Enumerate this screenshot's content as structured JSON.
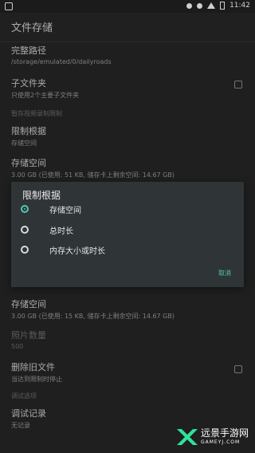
{
  "status_bar": {
    "time": "11:42"
  },
  "app_bar": {
    "title": "文件存储"
  },
  "settings": {
    "full_path": {
      "title": "完整路径",
      "subtitle": "/storage/emulated/0/dailyroads"
    },
    "subfolder": {
      "title": "子文件夹",
      "subtitle": "只使用2个主要子文件夹"
    },
    "category_limit": "暂存视频录制限制",
    "limit_basis": {
      "title": "限制根据",
      "subtitle": "存储空间"
    },
    "storage_space_1": {
      "title": "存储空间",
      "subtitle": "3.00 GB (已使用: 51 KB, 储存卡上剩余空间: 14.67 GB)"
    },
    "storage_space_2": {
      "title": "存储空间",
      "subtitle": "3.00 GB (已使用: 15 KB, 储存卡上剩余空间: 14.67 GB)"
    },
    "photo_count": {
      "title": "照片数量",
      "subtitle": "500"
    },
    "delete_old_files": {
      "title": "删除旧文件",
      "subtitle": "当达到限制时停止"
    },
    "category_debug": "调试选项",
    "debug_log": {
      "title": "调试记录",
      "subtitle": "无记录"
    }
  },
  "dialog": {
    "title": "限制根据",
    "options": [
      {
        "label": "存储空间",
        "checked": true
      },
      {
        "label": "总时长",
        "checked": false
      },
      {
        "label": "内存大小或时长",
        "checked": false
      }
    ],
    "cancel_label": "取消"
  },
  "watermark": {
    "text": "远景手游网",
    "subtext": "GAMEYJ.COM"
  },
  "colors": {
    "accent": "#51c6b5",
    "background": "#2a2a2a",
    "dialog": "#2f3437"
  }
}
